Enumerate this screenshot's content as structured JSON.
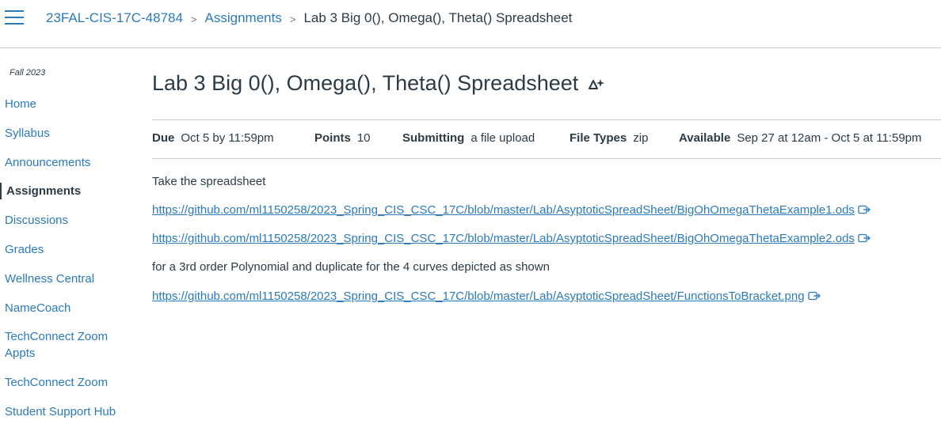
{
  "breadcrumb": {
    "course": "23FAL-CIS-17C-48784",
    "section": "Assignments",
    "current": "Lab 3 Big 0(), Omega(), Theta() Spreadsheet",
    "separator": ">"
  },
  "sidebar": {
    "term": "Fall 2023",
    "items": [
      {
        "label": "Home"
      },
      {
        "label": "Syllabus"
      },
      {
        "label": "Announcements"
      },
      {
        "label": "Assignments"
      },
      {
        "label": "Discussions"
      },
      {
        "label": "Grades"
      },
      {
        "label": "Wellness Central"
      },
      {
        "label": "NameCoach"
      },
      {
        "label": "TechConnect Zoom Appts"
      },
      {
        "label": "TechConnect Zoom"
      },
      {
        "label": "Student Support Hub"
      }
    ],
    "active_item": "Assignments"
  },
  "assignment": {
    "title": "Lab 3 Big 0(), Omega(), Theta() Spreadsheet",
    "due_label": "Due",
    "due_value": "Oct 5 by 11:59pm",
    "points_label": "Points",
    "points_value": "10",
    "submitting_label": "Submitting",
    "submitting_value": "a file upload",
    "filetypes_label": "File Types",
    "filetypes_value": "zip",
    "available_label": "Available",
    "available_value": "Sep 27 at 12am - Oct 5 at 11:59pm"
  },
  "description": {
    "intro": "Take the spreadsheet",
    "link1": "https://github.com/ml1150258/2023_Spring_CIS_CSC_17C/blob/master/Lab/AsyptoticSpreadSheet/BigOhOmegaThetaExample1.ods",
    "link2": "https://github.com/ml1150258/2023_Spring_CIS_CSC_17C/blob/master/Lab/AsyptoticSpreadSheet/BigOhOmegaThetaExample2.ods",
    "middle": "for a 3rd order Polynomial and duplicate for the 4 curves depicted as shown",
    "link3": "https://github.com/ml1150258/2023_Spring_CIS_CSC_17C/blob/master/Lab/AsyptoticSpreadSheet/FunctionsToBracket.png"
  },
  "colors": {
    "link": "#2b7abc",
    "text": "#2d3b45",
    "divider": "#c7cdd1"
  },
  "icons": {
    "menu": "hamburger-icon",
    "ai": "ai-sparkle-icon",
    "external": "external-link-icon"
  }
}
